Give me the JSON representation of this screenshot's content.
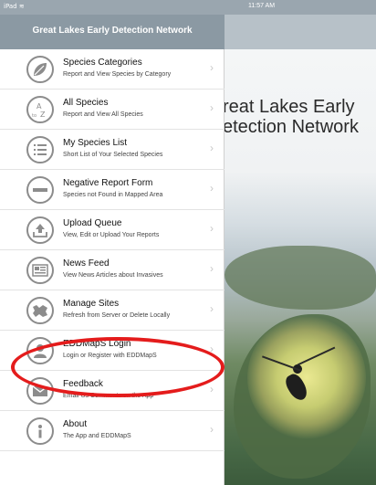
{
  "status_bar": {
    "device": "iPad",
    "wifi_icon": "wifi-icon",
    "time": "11:57 AM"
  },
  "nav": {
    "title": "Great Lakes Early Detection Network"
  },
  "menu": [
    {
      "icon": "leaf-icon",
      "title": "Species Categories",
      "subtitle": "Report and View Species by Category"
    },
    {
      "icon": "a-to-z-icon",
      "title": "All Species",
      "subtitle": "Report and View All Species"
    },
    {
      "icon": "list-icon",
      "title": "My Species List",
      "subtitle": "Short List of Your Selected Species"
    },
    {
      "icon": "minus-icon",
      "title": "Negative Report Form",
      "subtitle": "Species not Found in Mapped Area"
    },
    {
      "icon": "upload-icon",
      "title": "Upload Queue",
      "subtitle": "View, Edit or Upload Your Reports"
    },
    {
      "icon": "news-icon",
      "title": "News Feed",
      "subtitle": "View News Articles about Invasives"
    },
    {
      "icon": "map-icon",
      "title": "Manage Sites",
      "subtitle": "Refresh from Server or Delete Locally"
    },
    {
      "icon": "user-icon",
      "title": "EDDMapS Login",
      "subtitle": "Login or Register with EDDMapS"
    },
    {
      "icon": "email-icon",
      "title": "Feedback",
      "subtitle": "Email Us Comments on the App"
    },
    {
      "icon": "info-icon",
      "title": "About",
      "subtitle": "The App and EDDMapS"
    }
  ],
  "content": {
    "title_line1": "reat Lakes Early",
    "title_line2": "etection Network"
  },
  "colors": {
    "nav_bar": "#8b99a3",
    "highlight": "#e41c1c"
  }
}
